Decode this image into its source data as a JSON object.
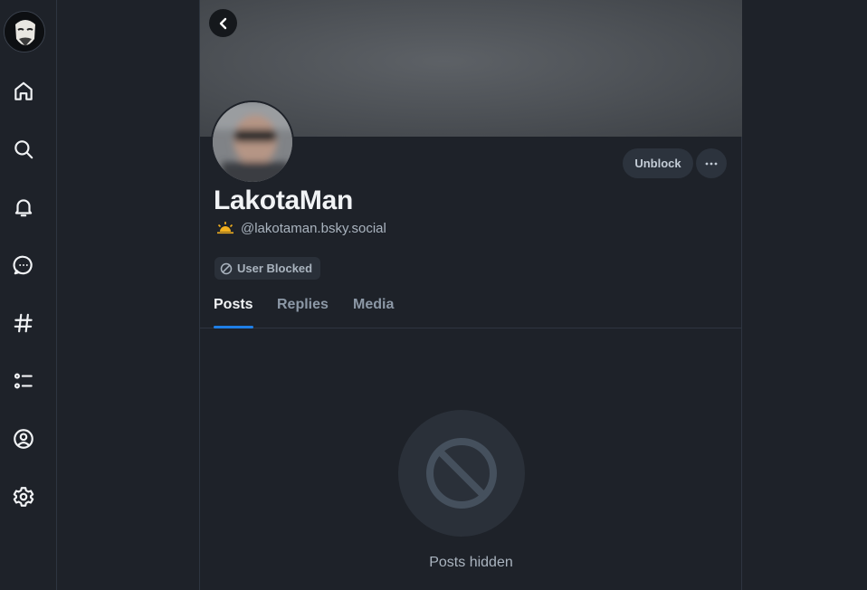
{
  "nav": {
    "items": [
      {
        "name": "home",
        "label": "Home"
      },
      {
        "name": "search",
        "label": "Search"
      },
      {
        "name": "notifications",
        "label": "Notifications"
      },
      {
        "name": "chat",
        "label": "Chat"
      },
      {
        "name": "feeds",
        "label": "Feeds"
      },
      {
        "name": "lists",
        "label": "Lists"
      },
      {
        "name": "profile",
        "label": "Profile"
      },
      {
        "name": "settings",
        "label": "Settings"
      }
    ]
  },
  "profile": {
    "display_name": "LakotaMan",
    "handle": "@lakotaman.bsky.social",
    "blocked_badge": "User Blocked",
    "unblock_label": "Unblock"
  },
  "tabs": [
    {
      "label": "Posts",
      "active": true
    },
    {
      "label": "Replies",
      "active": false
    },
    {
      "label": "Media",
      "active": false
    }
  ],
  "empty_state": {
    "text": "Posts hidden"
  },
  "colors": {
    "background": "#1e2229",
    "accent": "#1f7fe6",
    "icon": "#f1f3f5",
    "muted_text": "#aab4bf"
  }
}
